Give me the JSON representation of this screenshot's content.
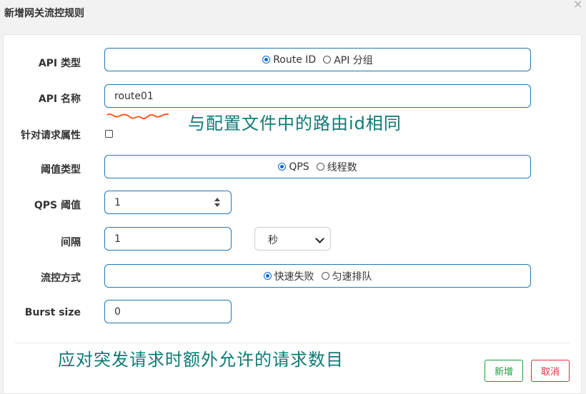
{
  "dialog": {
    "title": "新增网关流控规则",
    "close_glyph": "×"
  },
  "form": {
    "api_type": {
      "label": "API 类型",
      "options": [
        "Route ID",
        "API 分组"
      ],
      "selected": "Route ID"
    },
    "api_name": {
      "label": "API 名称",
      "value": "route01"
    },
    "param_flag": {
      "label": "针对请求属性",
      "checked": false
    },
    "threshold_type": {
      "label": "阈值类型",
      "options": [
        "QPS",
        "线程数"
      ],
      "selected": "QPS"
    },
    "qps_threshold": {
      "label": "QPS 阈值",
      "value": "1"
    },
    "interval": {
      "label": "间隔",
      "value": "1",
      "unit": "秒"
    },
    "control_behavior": {
      "label": "流控方式",
      "options": [
        "快速失败",
        "匀速排队"
      ],
      "selected": "快速失败"
    },
    "burst_size": {
      "label": "Burst size",
      "value": "0"
    }
  },
  "annotations": {
    "api_name_note": "与配置文件中的路由id相同",
    "burst_note": "应对突发请求时额外允许的请求数目",
    "color": "#0e7a74",
    "underline_color": "#ff5a1f"
  },
  "buttons": {
    "add": "新增",
    "cancel": "取消",
    "add_color": "#1a9c3c",
    "cancel_color": "#d9303e"
  },
  "colors": {
    "accent": "#1f78b4",
    "radio_selected": "#0b6ad8"
  }
}
